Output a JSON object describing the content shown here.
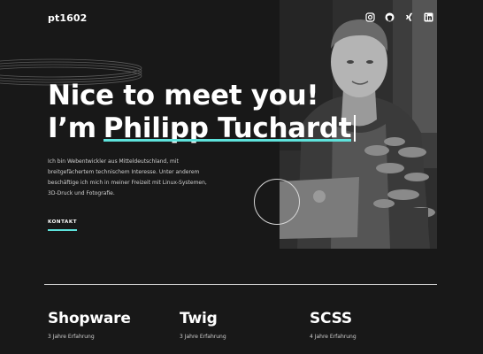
{
  "header": {
    "logo": "pt1602",
    "socials": [
      {
        "icon": "instagram-icon"
      },
      {
        "icon": "github-icon"
      },
      {
        "icon": "xing-icon"
      },
      {
        "icon": "linkedin-icon"
      }
    ]
  },
  "hero": {
    "line1": "Nice to meet you!",
    "line2_prefix": "I’m",
    "name": "Philipp Tuchardt",
    "bio": "Ich bin Webentwickler aus Mitteldeutschland, mit breitgefächertem technischem Interesse. Unter anderem beschäftige ich mich in meiner Freizeit mit Linux-Systemen, 3D-Druck und Fotografie.",
    "contact_label": "KONTAKT"
  },
  "skills": [
    {
      "title": "Shopware",
      "subtitle": "3 Jahre Erfahrung"
    },
    {
      "title": "Twig",
      "subtitle": "3 Jahre Erfahrung"
    },
    {
      "title": "SCSS",
      "subtitle": "4 Jahre Erfahrung"
    }
  ],
  "colors": {
    "accent": "#5ee3dc",
    "background": "#181818"
  }
}
